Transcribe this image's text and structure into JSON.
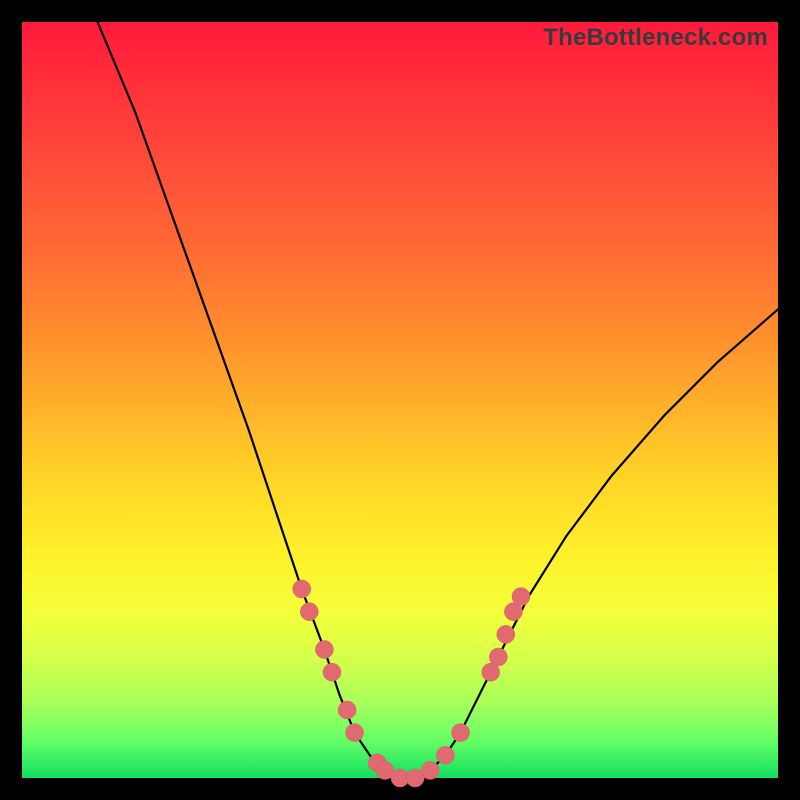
{
  "watermark": "TheBottleneck.com",
  "colors": {
    "background": "#000000",
    "curve": "#000000",
    "marker": "#e06a6f",
    "gradient_stops": [
      "#ff1a3c",
      "#ff4a3a",
      "#ff8a2e",
      "#ffd327",
      "#fff02a",
      "#d6ff4a",
      "#10e060"
    ]
  },
  "chart_data": {
    "type": "line",
    "title": "",
    "xlabel": "",
    "ylabel": "",
    "xlim": [
      0,
      100
    ],
    "ylim": [
      0,
      100
    ],
    "grid": false,
    "legend": false,
    "note": "No axis ticks or numeric labels are rendered in the image; values are estimated from pixel positions. y=0 is the bottom (green), y=100 is the top (red). Curve is a V-shaped dip reaching ~0 around x≈47–55.",
    "series": [
      {
        "name": "curve",
        "x": [
          10,
          15,
          20,
          25,
          30,
          34,
          37,
          40,
          42,
          44,
          46,
          48,
          50,
          52,
          54,
          56,
          58,
          60,
          63,
          67,
          72,
          78,
          85,
          92,
          100
        ],
        "y": [
          100,
          88,
          74,
          60,
          46,
          34,
          25,
          17,
          11,
          6,
          3,
          1,
          0,
          0,
          1,
          3,
          6,
          10,
          16,
          24,
          32,
          40,
          48,
          55,
          62
        ]
      }
    ],
    "markers": {
      "name": "highlighted-points",
      "rgb": "#e06a6f",
      "points": [
        {
          "x": 37,
          "y": 25
        },
        {
          "x": 38,
          "y": 22
        },
        {
          "x": 40,
          "y": 17
        },
        {
          "x": 41,
          "y": 14
        },
        {
          "x": 43,
          "y": 9
        },
        {
          "x": 44,
          "y": 6
        },
        {
          "x": 47,
          "y": 2
        },
        {
          "x": 48,
          "y": 1
        },
        {
          "x": 50,
          "y": 0
        },
        {
          "x": 52,
          "y": 0
        },
        {
          "x": 54,
          "y": 1
        },
        {
          "x": 56,
          "y": 3
        },
        {
          "x": 58,
          "y": 6
        },
        {
          "x": 62,
          "y": 14
        },
        {
          "x": 63,
          "y": 16
        },
        {
          "x": 64,
          "y": 19
        },
        {
          "x": 65,
          "y": 22
        },
        {
          "x": 66,
          "y": 24
        }
      ]
    }
  }
}
